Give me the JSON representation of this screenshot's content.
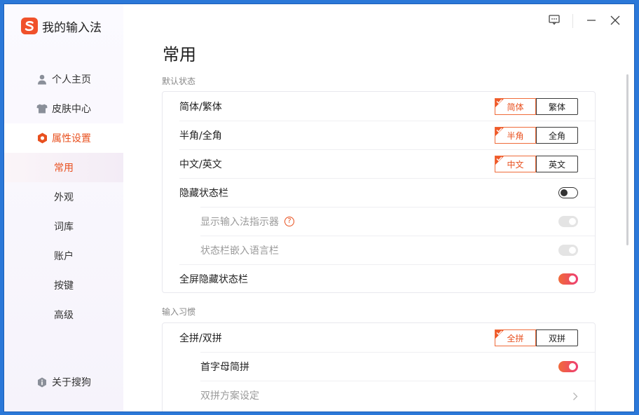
{
  "app": {
    "name": "我的输入法"
  },
  "titlebar": {
    "feedback_icon": "chat-icon",
    "minimize_icon": "minimize-icon",
    "close_icon": "close-icon"
  },
  "sidebar": {
    "items": [
      {
        "label": "个人主页",
        "icon": "person-icon"
      },
      {
        "label": "皮肤中心",
        "icon": "shirt-icon"
      },
      {
        "label": "属性设置",
        "icon": "hexagon-settings-icon",
        "active": true
      }
    ],
    "subitems": [
      {
        "label": "常用",
        "active": true
      },
      {
        "label": "外观"
      },
      {
        "label": "词库"
      },
      {
        "label": "账户"
      },
      {
        "label": "按键"
      },
      {
        "label": "高级"
      }
    ],
    "about": {
      "label": "关于搜狗",
      "icon": "info-icon"
    }
  },
  "main": {
    "title": "常用",
    "sections": [
      {
        "label": "默认状态",
        "rows": [
          {
            "label": "简体/繁体",
            "control": "segment",
            "options": [
              "简体",
              "繁体"
            ],
            "selected": 0
          },
          {
            "label": "半角/全角",
            "control": "segment",
            "options": [
              "半角",
              "全角"
            ],
            "selected": 0
          },
          {
            "label": "中文/英文",
            "control": "segment",
            "options": [
              "中文",
              "英文"
            ],
            "selected": 0
          },
          {
            "label": "隐藏状态栏",
            "control": "toggle",
            "state": "off"
          },
          {
            "label": "显示输入法指示器",
            "control": "toggle",
            "state": "disabled",
            "sub": true,
            "help": "?"
          },
          {
            "label": "状态栏嵌入语言栏",
            "control": "toggle",
            "state": "disabled",
            "sub": true
          },
          {
            "label": "全屏隐藏状态栏",
            "control": "toggle",
            "state": "on"
          }
        ]
      },
      {
        "label": "输入习惯",
        "rows": [
          {
            "label": "全拼/双拼",
            "control": "segment",
            "options": [
              "全拼",
              "双拼"
            ],
            "selected": 0
          },
          {
            "label": "首字母简拼",
            "control": "toggle",
            "state": "on",
            "sub": true
          },
          {
            "label": "双拼方案设定",
            "control": "chevron",
            "sub": true,
            "dim": true
          }
        ]
      }
    ]
  },
  "colors": {
    "accent": "#e8501f",
    "toggle_on_start": "#f06a3a",
    "toggle_on_end": "#ee3e73",
    "brand": "#f0512b"
  }
}
